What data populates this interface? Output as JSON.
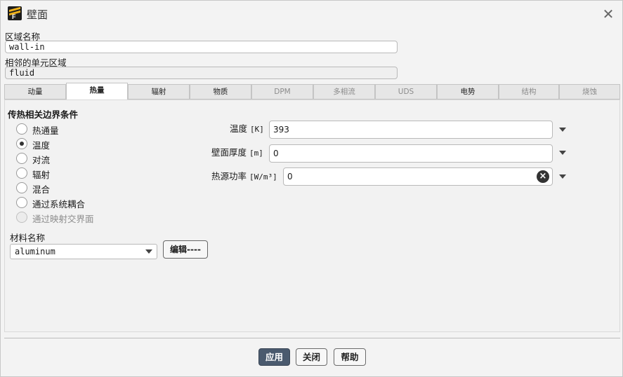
{
  "window": {
    "title": "壁面"
  },
  "zone_name": {
    "label": "区域名称",
    "value": "wall-in"
  },
  "adjacent_zone": {
    "label": "相邻的单元区域",
    "value": "fluid"
  },
  "tabs": [
    {
      "label": "动量",
      "active": false,
      "enabled": true
    },
    {
      "label": "热量",
      "active": true,
      "enabled": true
    },
    {
      "label": "辐射",
      "active": false,
      "enabled": true
    },
    {
      "label": "物质",
      "active": false,
      "enabled": true
    },
    {
      "label": "DPM",
      "active": false,
      "enabled": false
    },
    {
      "label": "多相流",
      "active": false,
      "enabled": false
    },
    {
      "label": "UDS",
      "active": false,
      "enabled": false
    },
    {
      "label": "电势",
      "active": false,
      "enabled": true
    },
    {
      "label": "结构",
      "active": false,
      "enabled": false
    },
    {
      "label": "烧蚀",
      "active": false,
      "enabled": false
    }
  ],
  "thermal": {
    "section_title": "传热相关边界条件",
    "options": [
      {
        "label": "热通量",
        "checked": false,
        "enabled": true
      },
      {
        "label": "温度",
        "checked": true,
        "enabled": true
      },
      {
        "label": "对流",
        "checked": false,
        "enabled": true
      },
      {
        "label": "辐射",
        "checked": false,
        "enabled": true
      },
      {
        "label": "混合",
        "checked": false,
        "enabled": true
      },
      {
        "label": "通过系统耦合",
        "checked": false,
        "enabled": true
      },
      {
        "label": "通过映射交界面",
        "checked": false,
        "enabled": false
      }
    ],
    "temperature": {
      "label": "温度",
      "unit": "[K]",
      "value": "393"
    },
    "wall_thickness": {
      "label": "壁面厚度",
      "unit": "[m]",
      "value": "0"
    },
    "heat_source": {
      "label": "热源功率",
      "unit": "[W/m³]",
      "value": "0"
    }
  },
  "material": {
    "label": "材料名称",
    "selected": "aluminum",
    "edit_label": "编辑----"
  },
  "footer": {
    "apply": "应用",
    "close": "关闭",
    "help": "帮助"
  }
}
